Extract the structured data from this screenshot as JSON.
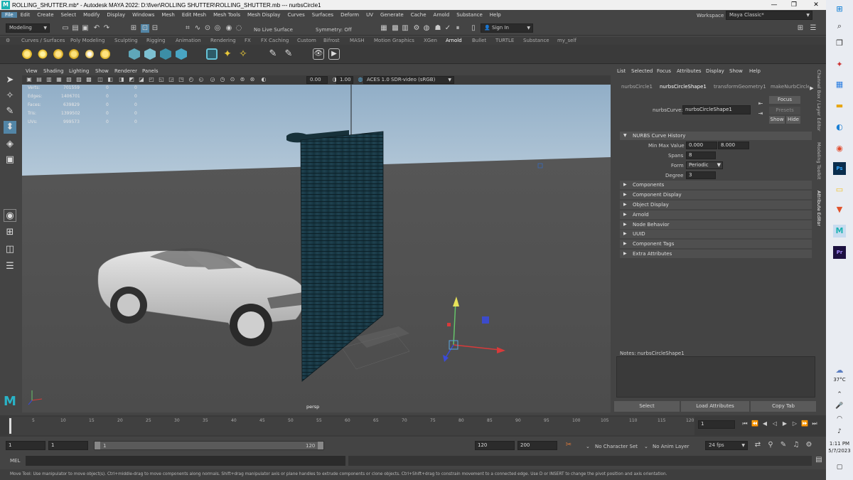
{
  "window": {
    "title": "ROLLING_SHUTTER.mb* - Autodesk MAYA 2022: D:\\fiver\\ROLLING SHUTTER\\ROLLING_SHUTTER.mb   ---   nurbsCircle1",
    "logo": "M"
  },
  "menubar": [
    "File",
    "Edit",
    "Create",
    "Select",
    "Modify",
    "Display",
    "Windows",
    "Mesh",
    "Edit Mesh",
    "Mesh Tools",
    "Mesh Display",
    "Curves",
    "Surfaces",
    "Deform",
    "UV",
    "Generate",
    "Cache",
    "Arnold",
    "Substance",
    "Help"
  ],
  "workspace": {
    "label": "Workspace :",
    "value": "Maya Classic*"
  },
  "statusline": {
    "menuset": "Modeling",
    "live_surface": "No Live Surface",
    "symmetry": "Symmetry: Off",
    "signin": "Sign In"
  },
  "shelf_tabs": [
    "Curves / Surfaces",
    "Poly Modeling",
    "Sculpting",
    "Rigging",
    "Animation",
    "Rendering",
    "FX",
    "FX Caching",
    "Custom",
    "Bifrost",
    "MASH",
    "Motion Graphics",
    "XGen",
    "Arnold",
    "Bullet",
    "TURTLE",
    "Substance",
    "my_self"
  ],
  "shelf_active": "Arnold",
  "viewport": {
    "menu": [
      "View",
      "Shading",
      "Lighting",
      "Show",
      "Renderer",
      "Panels"
    ],
    "gamma_a": "0.00",
    "gamma_b": "1.00",
    "colorspace": "ACES 1.0 SDR-video (sRGB)",
    "camera": "persp",
    "hud": [
      {
        "label": "Verts:",
        "v1": "701559",
        "v2": "0",
        "v3": "0"
      },
      {
        "label": "Edges:",
        "v1": "1406701",
        "v2": "0",
        "v3": "0"
      },
      {
        "label": "Faces:",
        "v1": "639829",
        "v2": "0",
        "v3": "0"
      },
      {
        "label": "Tris:",
        "v1": "1399502",
        "v2": "0",
        "v3": "0"
      },
      {
        "label": "UVs:",
        "v1": "999573",
        "v2": "0",
        "v3": "0"
      }
    ]
  },
  "attribute_editor": {
    "menu": [
      "List",
      "Selected",
      "Focus",
      "Attributes",
      "Display",
      "Show",
      "Help"
    ],
    "tabs": [
      "nurbsCircle1",
      "nurbsCircleShape1",
      "transformGeometry1",
      "makeNurbCircle1"
    ],
    "node_label": "nurbsCurve:",
    "node_value": "nurbsCircleShape1",
    "focus": "Focus",
    "presets": "Presets",
    "show": "Show",
    "hide": "Hide",
    "history_title": "NURBS Curve History",
    "min_max_label": "Min Max Value",
    "min_value": "0.000",
    "max_value": "8.000",
    "spans_label": "Spans",
    "spans_value": "8",
    "form_label": "Form",
    "form_value": "Periodic",
    "degree_label": "Degree",
    "degree_value": "3",
    "sections": [
      "Components",
      "Component Display",
      "Object Display",
      "Arnold",
      "Node Behavior",
      "UUID",
      "Component Tags",
      "Extra Attributes"
    ],
    "notes": "Notes:  nurbsCircleShape1",
    "buttons": [
      "Select",
      "Load Attributes",
      "Copy Tab"
    ]
  },
  "side_tabs": [
    "Channel Box / Layer Editor",
    "Modeling Toolkit",
    "Attribute Editor"
  ],
  "timeline": {
    "ticks": [
      "5",
      "10",
      "15",
      "20",
      "25",
      "30",
      "35",
      "40",
      "45",
      "50",
      "55",
      "60",
      "65",
      "70",
      "75",
      "80",
      "85",
      "90",
      "95",
      "100",
      "105",
      "110",
      "115",
      "120"
    ],
    "current_frame": "1",
    "start_label": "1"
  },
  "range": {
    "start": "1",
    "start2": "1",
    "slider_start": "1",
    "slider_end": "120",
    "end": "120",
    "end2": "200",
    "character_set": "No Character Set",
    "anim_layer": "No Anim Layer",
    "fps": "24 fps"
  },
  "cmdline": {
    "label": "MEL"
  },
  "helpline": "Move Tool: Use manipulator to move object(s). Ctrl+middle-drag to move components along normals. Shift+drag manipulator axis or plane handles to extrude components or clone objects. Ctrl+Shift+drag to constrain movement to a connected edge. Use D or INSERT to change the pivot position and axis orientation.",
  "taskbar": {
    "temperature": "37°C",
    "time": "1:11 PM",
    "date": "5/7/2023"
  },
  "colors": {
    "viewport_sky": "#90aec8",
    "viewport_floor": "#505050",
    "shutter": "#1d3a44",
    "accent": "#5285a6"
  }
}
